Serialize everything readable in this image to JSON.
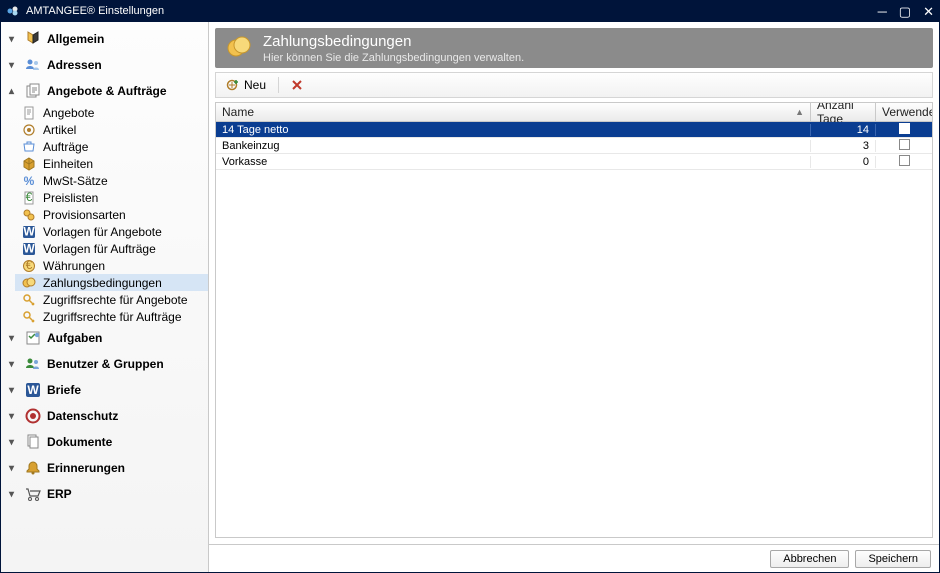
{
  "window": {
    "title": "AMTANGEE® Einstellungen"
  },
  "sidebar": {
    "groups": [
      {
        "label": "Allgemein",
        "expanded": false,
        "icon": "general-icon"
      },
      {
        "label": "Adressen",
        "expanded": false,
        "icon": "addresses-icon"
      },
      {
        "label": "Angebote & Aufträge",
        "expanded": true,
        "icon": "offers-icon",
        "items": [
          {
            "label": "Angebote",
            "icon": "doc-icon"
          },
          {
            "label": "Artikel",
            "icon": "article-icon"
          },
          {
            "label": "Aufträge",
            "icon": "order-icon"
          },
          {
            "label": "Einheiten",
            "icon": "cube-icon"
          },
          {
            "label": "MwSt-Sätze",
            "icon": "percent-icon"
          },
          {
            "label": "Preislisten",
            "icon": "pricelist-icon"
          },
          {
            "label": "Provisionsarten",
            "icon": "commission-icon"
          },
          {
            "label": "Vorlagen für Angebote",
            "icon": "word-icon"
          },
          {
            "label": "Vorlagen für Aufträge",
            "icon": "word-icon"
          },
          {
            "label": "Währungen",
            "icon": "currency-icon"
          },
          {
            "label": "Zahlungsbedingungen",
            "icon": "payment-icon",
            "selected": true
          },
          {
            "label": "Zugriffsrechte für Angebote",
            "icon": "key-icon"
          },
          {
            "label": "Zugriffsrechte für Aufträge",
            "icon": "key-icon"
          }
        ]
      },
      {
        "label": "Aufgaben",
        "expanded": false,
        "icon": "tasks-icon"
      },
      {
        "label": "Benutzer & Gruppen",
        "expanded": false,
        "icon": "users-icon"
      },
      {
        "label": "Briefe",
        "expanded": false,
        "icon": "letters-icon"
      },
      {
        "label": "Datenschutz",
        "expanded": false,
        "icon": "privacy-icon"
      },
      {
        "label": "Dokumente",
        "expanded": false,
        "icon": "documents-icon"
      },
      {
        "label": "Erinnerungen",
        "expanded": false,
        "icon": "reminders-icon"
      },
      {
        "label": "ERP",
        "expanded": false,
        "icon": "erp-icon"
      }
    ]
  },
  "banner": {
    "title": "Zahlungsbedingungen",
    "subtitle": "Hier können Sie die Zahlungsbedingungen verwalten."
  },
  "toolbar": {
    "new_label": "Neu"
  },
  "grid": {
    "columns": {
      "name": "Name",
      "days": "Anzahl Tage",
      "used": "Verwendet"
    },
    "rows": [
      {
        "name": "14 Tage netto",
        "days": "14",
        "used": false,
        "selected": true
      },
      {
        "name": "Bankeinzug",
        "days": "3",
        "used": false,
        "selected": false
      },
      {
        "name": "Vorkasse",
        "days": "0",
        "used": false,
        "selected": false
      }
    ]
  },
  "footer": {
    "cancel": "Abbrechen",
    "save": "Speichern"
  }
}
